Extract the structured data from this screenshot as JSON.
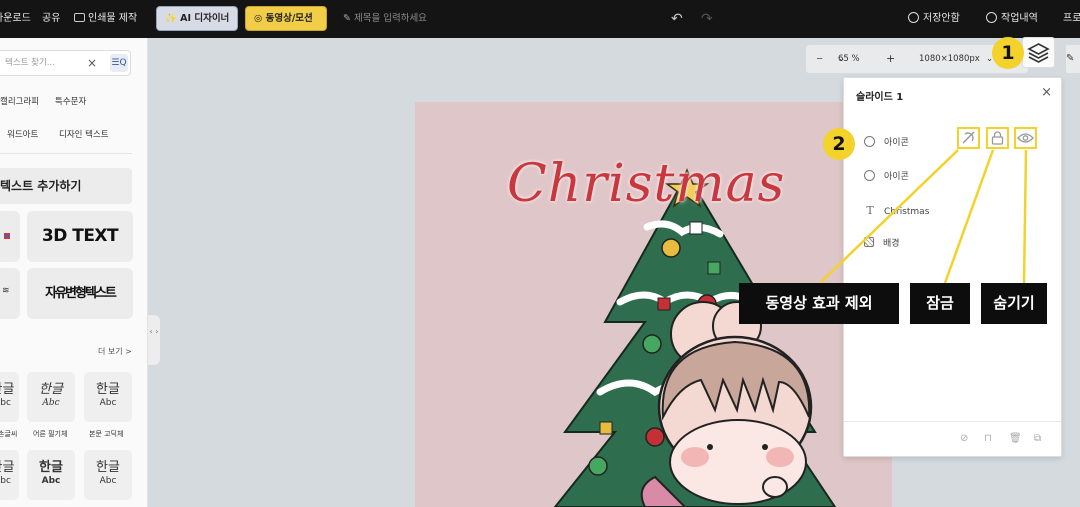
{
  "topbar": {
    "download": "다운로드",
    "share": "공유",
    "print": "인쇄물 제작",
    "ai_designer": "AI 디자이너",
    "video_motion": "동영상/모션",
    "title_placeholder": "제목을 입력하세요",
    "undo": "↶",
    "redo": "↷",
    "save_status": "저장안함",
    "history": "작업내역",
    "profile": "프로"
  },
  "left_panel": {
    "search_placeholder": "텍스트 찾기...",
    "clear": "×",
    "filter": "☰Q",
    "tags_row1": [
      "캘리그라피",
      "특수문자"
    ],
    "tags_row2": [
      "워드아트",
      "디자인 텍스트"
    ],
    "add_text": "텍스트 추가하기",
    "tile_3d": "3D TEXT",
    "tile_free": "자유변형텍스트",
    "more": "더 보기 >",
    "fonts_row1": [
      {
        "main": "한글",
        "sub": "Abc",
        "caption": "손글씨"
      },
      {
        "main": "한글",
        "sub": "Abc",
        "caption": "어른 필기체"
      },
      {
        "main": "한글",
        "sub": "Abc",
        "caption": "본문 고딕체"
      }
    ],
    "fonts_row2": [
      {
        "main": "한글",
        "sub": "Abc"
      },
      {
        "main": "한글",
        "sub": "Abc"
      },
      {
        "main": "한글",
        "sub": "Abc"
      }
    ],
    "collapse": "‹ ›"
  },
  "zoom": {
    "minus": "−",
    "level": "65 %",
    "plus": "+",
    "size": "1080×1080px"
  },
  "canvas": {
    "title": "Christmas"
  },
  "layer_panel": {
    "title": "슬라이드 1",
    "close": "×",
    "layers": [
      {
        "type": "icon",
        "label": "아이콘"
      },
      {
        "type": "icon",
        "label": "아이콘"
      },
      {
        "type": "text",
        "label": "Christmas"
      },
      {
        "type": "background",
        "label": "배경"
      }
    ],
    "text_icon": "T"
  },
  "annotations": {
    "badge1": "1",
    "badge2": "2",
    "exclude_effect": "동영상 효과 제외",
    "lock": "잠금",
    "hide": "숨기기",
    "color": "#f3d22b"
  }
}
